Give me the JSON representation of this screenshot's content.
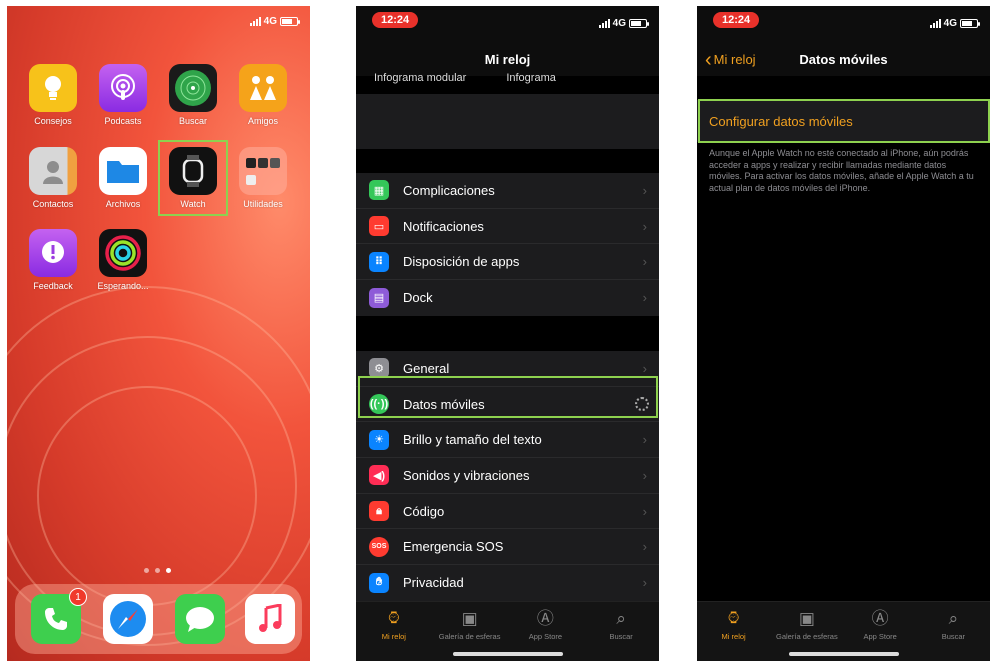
{
  "status": {
    "network": "4G"
  },
  "home": {
    "apps": [
      {
        "label": "Consejos",
        "icon": "lightbulb-icon",
        "color": "#f7c21a"
      },
      {
        "label": "Podcasts",
        "icon": "podcast-icon",
        "color": "#9b3de0"
      },
      {
        "label": "Buscar",
        "icon": "radar-icon",
        "color": "#1f8a3a"
      },
      {
        "label": "Amigos",
        "icon": "friends-icon",
        "color": "#f5a31a"
      },
      {
        "label": "Contactos",
        "icon": "contacts-icon",
        "color": "#b6b6b6"
      },
      {
        "label": "Archivos",
        "icon": "folder-icon",
        "color": "#1e88e5"
      },
      {
        "label": "Watch",
        "icon": "watch-icon",
        "color": "#111111"
      },
      {
        "label": "Utilidades",
        "icon": "folder-grid-icon",
        "color": "#f08070"
      },
      {
        "label": "Feedback",
        "icon": "feedback-icon",
        "color": "#b04ae0"
      },
      {
        "label": "Esperando...",
        "icon": "activity-rings-icon",
        "color": "#111111"
      }
    ],
    "dock": [
      {
        "name": "phone",
        "icon": "phone-icon",
        "color": "#3ecf4e",
        "badge": "1"
      },
      {
        "name": "safari",
        "icon": "compass-icon",
        "color": "#ffffff"
      },
      {
        "name": "messages",
        "icon": "message-icon",
        "color": "#3ecf4e"
      },
      {
        "name": "music",
        "icon": "music-note-icon",
        "color": "#ffffff"
      }
    ]
  },
  "watch_app": {
    "time": "12:24",
    "title": "Mi reloj",
    "faces": [
      "Infograma modular",
      "Infograma"
    ],
    "group1": [
      {
        "label": "Complicaciones",
        "color": "#34c759"
      },
      {
        "label": "Notificaciones",
        "color": "#ff3b30"
      },
      {
        "label": "Disposición de apps",
        "color": "#0a84ff"
      },
      {
        "label": "Dock",
        "color": "#8e5bd8"
      }
    ],
    "group2": [
      {
        "label": "General",
        "color": "#8e8e93"
      },
      {
        "label": "Datos móviles",
        "color": "#34c759"
      },
      {
        "label": "Brillo y tamaño del texto",
        "color": "#0a84ff"
      },
      {
        "label": "Sonidos y vibraciones",
        "color": "#ff2d55"
      },
      {
        "label": "Código",
        "color": "#ff3b30"
      },
      {
        "label": "Emergencia SOS",
        "color": "#ff3b30",
        "glyph": "SOS"
      },
      {
        "label": "Privacidad",
        "color": "#0a84ff"
      }
    ],
    "tabs": [
      "Mi reloj",
      "Galería de esferas",
      "App Store",
      "Buscar"
    ]
  },
  "cellular": {
    "time": "12:24",
    "back_label": "Mi reloj",
    "title": "Datos móviles",
    "configure_label": "Configurar datos móviles",
    "description": "Aunque el Apple Watch no esté conectado al iPhone, aún podrás acceder a apps y realizar y recibir llamadas mediante datos móviles. Para activar los datos móviles, añade el Apple Watch a tu actual plan de datos móviles del iPhone.",
    "tabs": [
      "Mi reloj",
      "Galería de esferas",
      "App Store",
      "Buscar"
    ]
  },
  "colors": {
    "accent": "#f0a020",
    "highlight": "#8ed14f",
    "pill": "#e8312a"
  }
}
